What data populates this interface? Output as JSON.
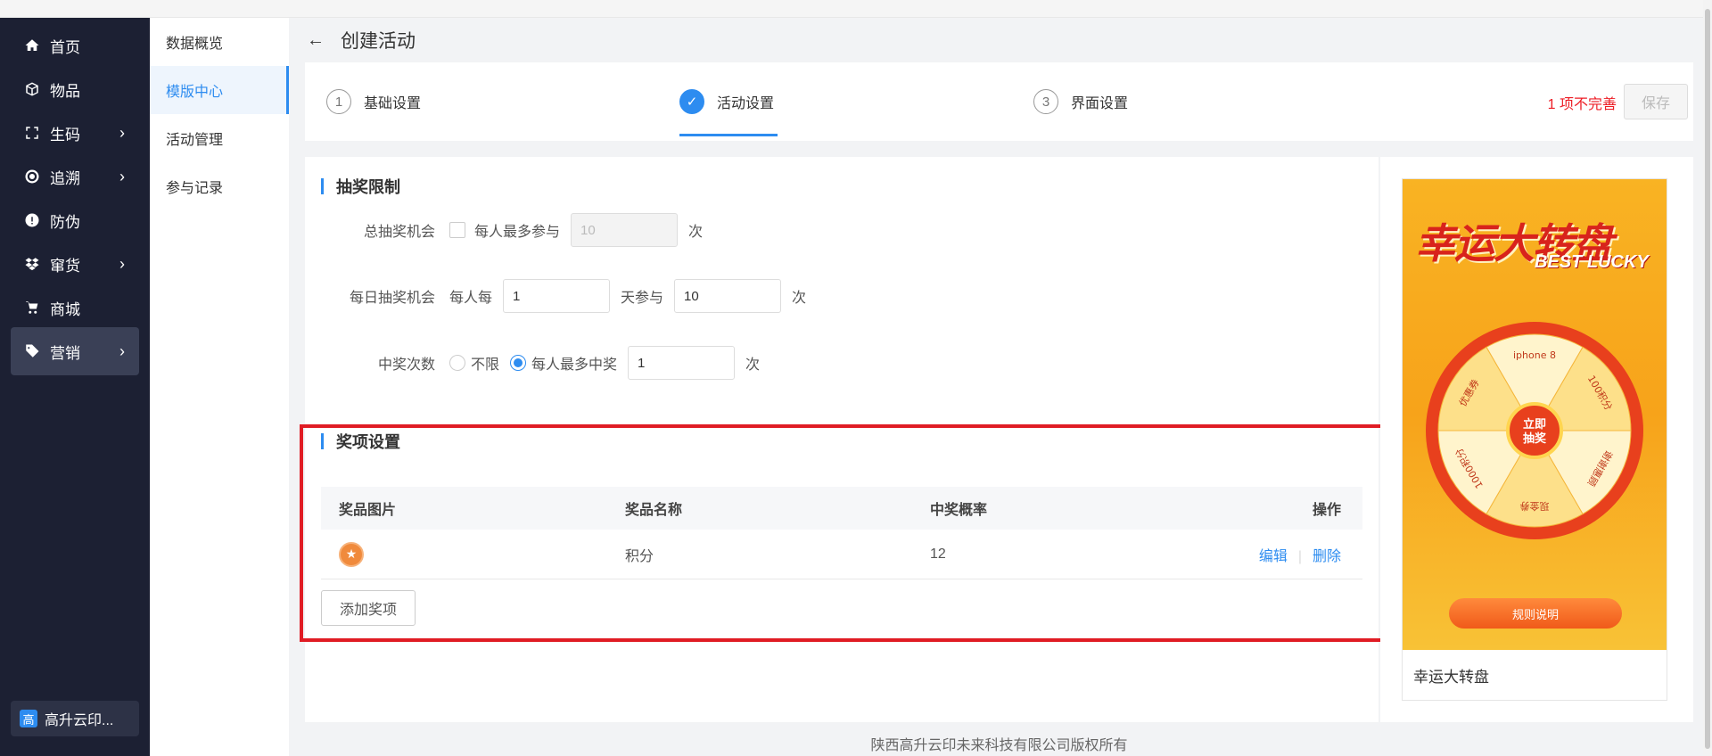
{
  "sidebar": {
    "items": [
      {
        "label": "首页",
        "icon": "home-icon"
      },
      {
        "label": "物品",
        "icon": "box-icon"
      },
      {
        "label": "生码",
        "icon": "scan-icon"
      },
      {
        "label": "追溯",
        "icon": "target-icon"
      },
      {
        "label": "防伪",
        "icon": "alert-icon"
      },
      {
        "label": "窜货",
        "icon": "dropbox-icon"
      },
      {
        "label": "商城",
        "icon": "cart-icon"
      },
      {
        "label": "营销",
        "icon": "tag-icon"
      }
    ],
    "chevron": "›",
    "company": {
      "logo_char": "高",
      "label": "高升云印..."
    }
  },
  "submenu": {
    "items": [
      "数据概览",
      "模版中心",
      "活动管理",
      "参与记录"
    ]
  },
  "header": {
    "back": "←",
    "title": "创建活动"
  },
  "steps": {
    "items": [
      {
        "num": "1",
        "label": "基础设置"
      },
      {
        "num": "✓",
        "label": "活动设置"
      },
      {
        "num": "3",
        "label": "界面设置"
      }
    ],
    "incomplete": "1 项不完善",
    "save": "保存"
  },
  "limits": {
    "title": "抽奖限制",
    "total": {
      "label": "总抽奖机会",
      "check_label": "每人最多参与",
      "value": "10",
      "unit": "次"
    },
    "daily": {
      "label": "每日抽奖机会",
      "prefix": "每人每",
      "days": "1",
      "mid": "天参与",
      "times": "10",
      "unit": "次"
    },
    "wins": {
      "label": "中奖次数",
      "opt1": "不限",
      "opt2": "每人最多中奖",
      "value": "1",
      "unit": "次"
    }
  },
  "prizes": {
    "title": "奖项设置",
    "columns": [
      "奖品图片",
      "奖品名称",
      "中奖概率",
      "操作"
    ],
    "rows": [
      {
        "name": "积分",
        "rate": "12",
        "edit": "编辑",
        "delete": "删除"
      }
    ],
    "add": "添加奖项"
  },
  "preview": {
    "title": "幸运大转盘",
    "title_en": "BEST LUCKY",
    "wheel": {
      "center": "立即抽奖",
      "segments": [
        "iphone 8",
        "100积分",
        "谢谢惠顾",
        "现金券",
        "1000积分",
        "优惠券"
      ]
    },
    "rules": "规则说明",
    "caption": "幸运大转盘"
  },
  "footer": "陕西高升云印未来科技有限公司版权所有",
  "colors": {
    "accent": "#2d8cf0",
    "sidebar": "#1c2033",
    "error": "#ed1c24",
    "highlight_box": "#e01c24"
  }
}
